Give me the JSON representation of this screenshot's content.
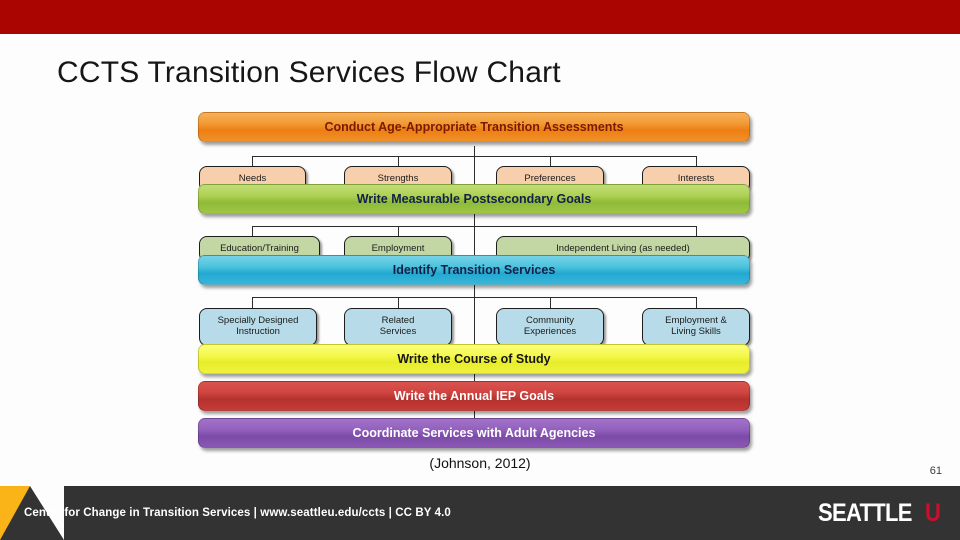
{
  "slide": {
    "title": "CCTS Transition Services Flow Chart",
    "citation": "(Johnson, 2012)",
    "page_number": "61"
  },
  "theme": {
    "top_band_color": "#aa0500",
    "footer_color": "#333333",
    "footer_accent_color": "#fbb418",
    "logo_accent_color": "#c8102e"
  },
  "chart_data": {
    "type": "diagram",
    "title": "CCTS Transition Services Flow Chart",
    "source": "(Johnson, 2012)",
    "stages": [
      {
        "label": "Conduct Age-Appropriate Transition Assessments",
        "color": "#ed7f12",
        "color_name": "orange",
        "text_color": "#7a1a05",
        "children": [
          {
            "label": "Needs"
          },
          {
            "label": "Strengths"
          },
          {
            "label": "Preferences"
          },
          {
            "label": "Interests"
          }
        ],
        "child_color": "#f8cfad"
      },
      {
        "label": "Write Measurable Postsecondary  Goals",
        "color": "#8fbb39",
        "color_name": "green",
        "text_color": "#12204a",
        "children": [
          {
            "label": "Education/Training"
          },
          {
            "label": "Employment"
          },
          {
            "label": "Independent Living (as needed)"
          }
        ],
        "child_color": "#c3d7a4"
      },
      {
        "label": "Identify Transition  Services",
        "color": "#22a9d1",
        "color_name": "blue",
        "text_color": "#12204a",
        "children": [
          {
            "label": "Specially Designed\nInstruction"
          },
          {
            "label": "Related\nServices"
          },
          {
            "label": "Community\nExperiences"
          },
          {
            "label": "Employment  &\nLiving Skills"
          }
        ],
        "child_color": "#b7dbe9"
      },
      {
        "label": "Write the Course of Study",
        "color": "#e8ed2a",
        "color_name": "yellow",
        "text_color": "#161616",
        "children": []
      },
      {
        "label": "Write the Annual IEP Goals",
        "color": "#b5322f",
        "color_name": "red",
        "text_color": "#ffffff",
        "children": []
      },
      {
        "label": "Coordinate Services with Adult Agencies",
        "color": "#7c4aa8",
        "color_name": "purple",
        "text_color": "#ffffff",
        "children": []
      }
    ]
  },
  "footer": {
    "text": "Center for Change in Transition Services | www.seattleu.edu/ccts | CC BY 4.0",
    "logo_word": "SEATTLE",
    "logo_mark": "U"
  }
}
